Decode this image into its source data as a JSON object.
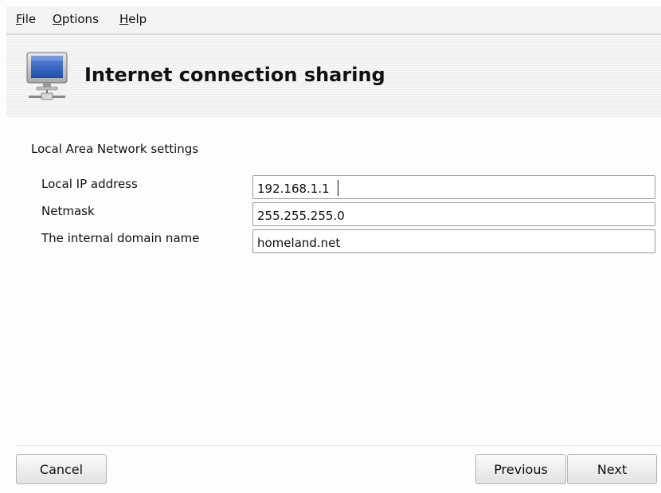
{
  "menu": {
    "file": {
      "mnemonic": "F",
      "rest": "ile"
    },
    "options": {
      "mnemonic": "O",
      "rest": "ptions"
    },
    "help": {
      "mnemonic": "H",
      "rest": "elp"
    }
  },
  "header": {
    "title": "Internet connection sharing",
    "icon": "network-computer-icon"
  },
  "form": {
    "section_title": "Local Area Network settings",
    "fields": [
      {
        "label": "Local IP address",
        "value": "192.168.1.1"
      },
      {
        "label": "Netmask",
        "value": "255.255.255.0"
      },
      {
        "label": "The internal domain name",
        "value": "homeland.net"
      }
    ]
  },
  "buttons": {
    "cancel": "Cancel",
    "previous": "Previous",
    "next": "Next"
  }
}
